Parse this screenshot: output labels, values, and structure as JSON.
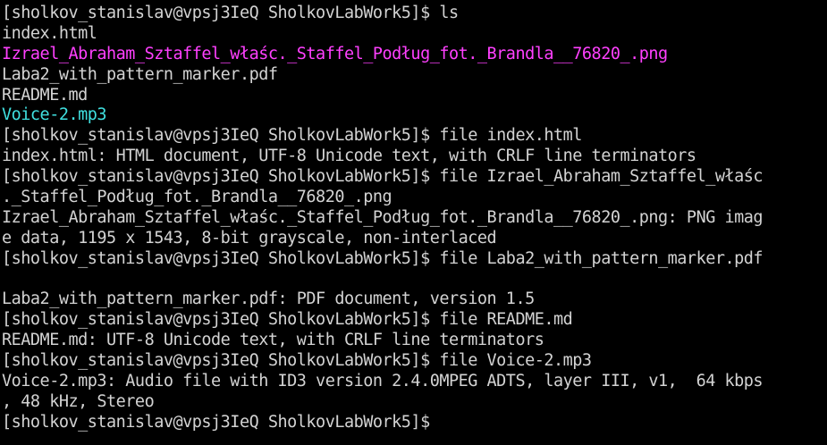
{
  "terminal": {
    "colors": {
      "background": "#000000",
      "text": "#d3d3d3",
      "image_file": "#ff40ff",
      "audio_file": "#40e0e0"
    },
    "lines": [
      {
        "text": "[sholkov_stanislav@vpsj3IeQ SholkovLabWork5]$ ls",
        "color": "#d3d3d3"
      },
      {
        "text": "index.html",
        "color": "#d3d3d3"
      },
      {
        "text": "Izrael_Abraham_Sztaffel_właśc._Staffel_Podług_fot._Brandla__76820_.png",
        "color": "#ff40ff"
      },
      {
        "text": "Laba2_with_pattern_marker.pdf",
        "color": "#d3d3d3"
      },
      {
        "text": "README.md",
        "color": "#d3d3d3"
      },
      {
        "text": "Voice-2.mp3",
        "color": "#40e0e0"
      },
      {
        "text": "[sholkov_stanislav@vpsj3IeQ SholkovLabWork5]$ file index.html",
        "color": "#d3d3d3"
      },
      {
        "text": "index.html: HTML document, UTF-8 Unicode text, with CRLF line terminators",
        "color": "#d3d3d3"
      },
      {
        "text": "[sholkov_stanislav@vpsj3IeQ SholkovLabWork5]$ file Izrael_Abraham_Sztaffel_właśc",
        "color": "#d3d3d3"
      },
      {
        "text": "._Staffel_Podług_fot._Brandla__76820_.png",
        "color": "#d3d3d3"
      },
      {
        "text": "Izrael_Abraham_Sztaffel_właśc._Staffel_Podług_fot._Brandla__76820_.png: PNG imag",
        "color": "#d3d3d3"
      },
      {
        "text": "e data, 1195 x 1543, 8-bit grayscale, non-interlaced",
        "color": "#d3d3d3"
      },
      {
        "text": "[sholkov_stanislav@vpsj3IeQ SholkovLabWork5]$ file Laba2_with_pattern_marker.pdf",
        "color": "#d3d3d3"
      },
      {
        "text": "",
        "color": "#d3d3d3"
      },
      {
        "text": "Laba2_with_pattern_marker.pdf: PDF document, version 1.5",
        "color": "#d3d3d3"
      },
      {
        "text": "[sholkov_stanislav@vpsj3IeQ SholkovLabWork5]$ file README.md",
        "color": "#d3d3d3"
      },
      {
        "text": "README.md: UTF-8 Unicode text, with CRLF line terminators",
        "color": "#d3d3d3"
      },
      {
        "text": "[sholkov_stanislav@vpsj3IeQ SholkovLabWork5]$ file Voice-2.mp3",
        "color": "#d3d3d3"
      },
      {
        "text": "Voice-2.mp3: Audio file with ID3 version 2.4.0MPEG ADTS, layer III, v1,  64 kbps",
        "color": "#d3d3d3"
      },
      {
        "text": ", 48 kHz, Stereo",
        "color": "#d3d3d3"
      },
      {
        "text": "[sholkov_stanislav@vpsj3IeQ SholkovLabWork5]$ ",
        "color": "#d3d3d3"
      }
    ]
  }
}
